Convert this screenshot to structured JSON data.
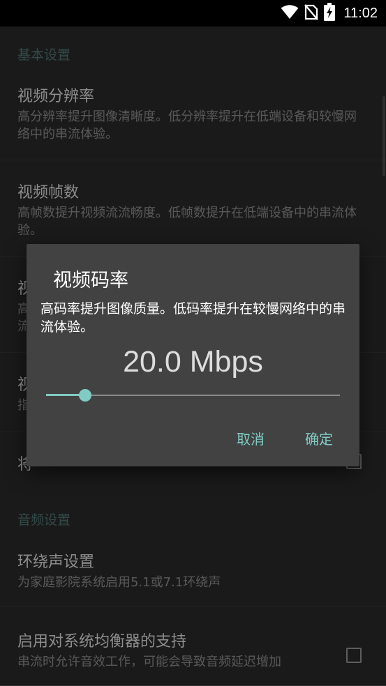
{
  "status_bar": {
    "time": "11:02",
    "icons": [
      "wifi-icon",
      "no-sim-icon",
      "battery-charging-icon"
    ]
  },
  "settings": {
    "categories": [
      "基本设置",
      "音频设置"
    ],
    "items": [
      {
        "title": "视频分辨率",
        "summary": "高分辨率提升图像清晰度。低分辨率提升在低端设备和较慢网络中的串流体验。"
      },
      {
        "title": "视频帧数",
        "summary": "高帧数提升视频流流畅度。低帧数提升在低端设备中的串流体验。"
      },
      {
        "title": "视",
        "summary": "高流"
      },
      {
        "title": "视",
        "summary": "指"
      },
      {
        "title": "将",
        "summary": ""
      },
      {
        "title": "环绕声设置",
        "summary": "为家庭影院系统启用5.1或7.1环绕声"
      },
      {
        "title": "启用对系统均衡器的支持",
        "summary": "串流时允许音效工作，可能会导致音频延迟增加"
      }
    ]
  },
  "dialog": {
    "title": "视频码率",
    "message": "高码率提升图像质量。低码率提升在较慢网络中的串流体验。",
    "value_text": "20.0 Mbps",
    "slider_fraction": 0.133,
    "cancel_label": "取消",
    "ok_label": "确定"
  },
  "colors": {
    "accent": "#80cbc4",
    "background": "#303030",
    "dialog": "#424242"
  }
}
